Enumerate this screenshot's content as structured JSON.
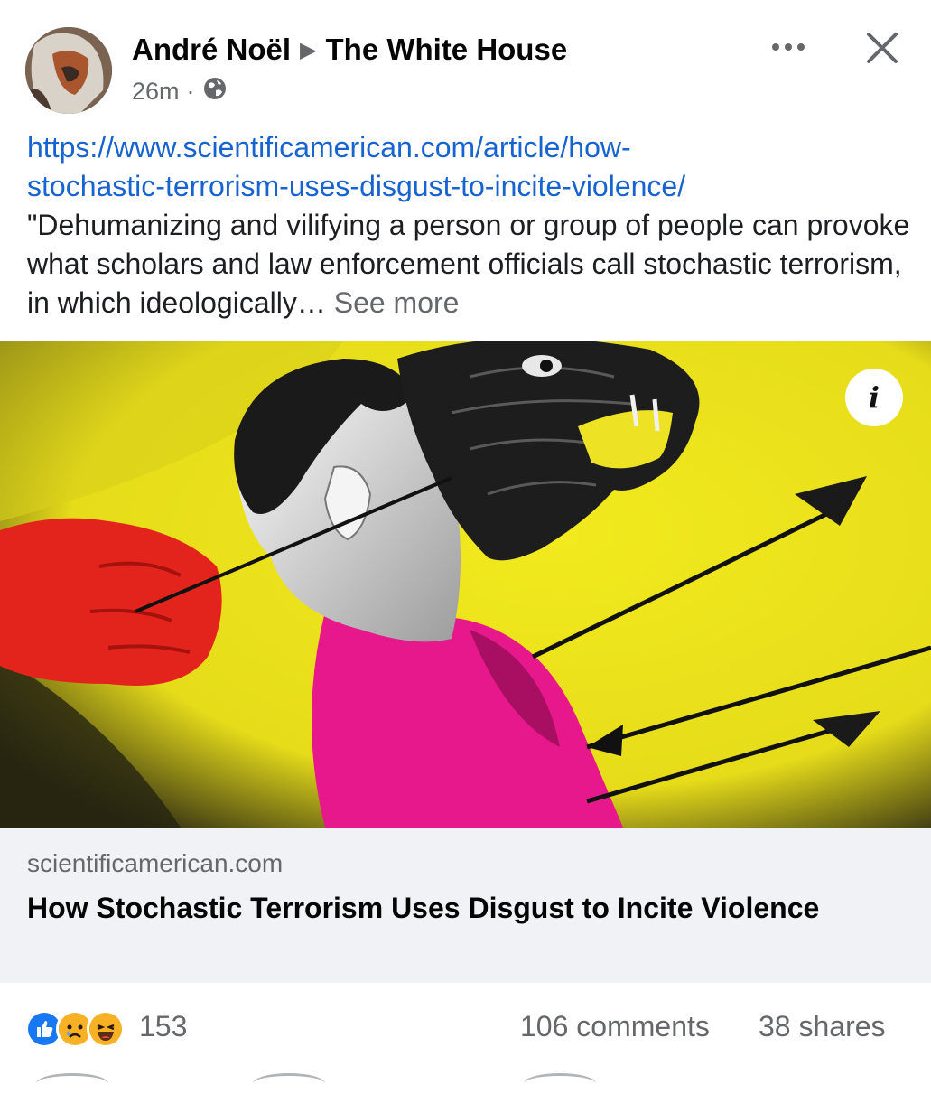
{
  "post": {
    "author": "André Noël",
    "target": "The White House",
    "time": "26m",
    "separator": "·",
    "link_url_line1": "https://www.scientificamerican.com/article/how-",
    "link_url_line2": "stochastic-terrorism-uses-disgust-to-incite-violence/",
    "body_text": "\"Dehumanizing and vilifying a person or group of people can provoke what scholars and law enforcement officials call stochastic terrorism, in which ideologically…",
    "see_more": "See more"
  },
  "link_card": {
    "domain": "scientificamerican.com",
    "title": "How Stochastic Terrorism Uses Disgust to Incite Violence",
    "info_glyph": "i"
  },
  "stats": {
    "reaction_count": "153",
    "comments": "106 comments",
    "shares": "38 shares"
  },
  "icons": {
    "more": "more-horizontal-icon",
    "close": "close-icon",
    "privacy": "globe-icon"
  },
  "colors": {
    "link_blue": "#1763cf",
    "secondary": "#65676b",
    "like_blue": "#1877f2",
    "card_bg": "#f0f2f5"
  }
}
